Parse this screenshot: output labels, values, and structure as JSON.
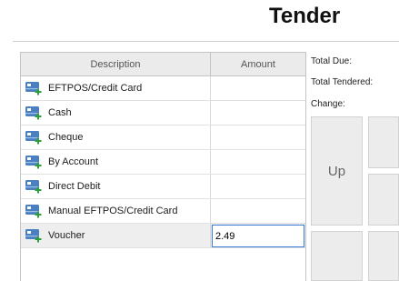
{
  "page": {
    "title": "Tender"
  },
  "grid": {
    "columns": {
      "description": "Description",
      "amount": "Amount"
    },
    "rows": [
      {
        "description": "EFTPOS/Credit Card",
        "amount": "",
        "icon": "card-payment-icon"
      },
      {
        "description": "Cash",
        "amount": "",
        "icon": "card-payment-icon"
      },
      {
        "description": "Cheque",
        "amount": "",
        "icon": "card-payment-icon"
      },
      {
        "description": "By Account",
        "amount": "",
        "icon": "card-payment-icon"
      },
      {
        "description": "Direct Debit",
        "amount": "",
        "icon": "card-payment-icon"
      },
      {
        "description": "Manual EFTPOS/Credit Card",
        "amount": "",
        "icon": "card-payment-icon"
      },
      {
        "description": "Voucher",
        "amount": "2.49",
        "icon": "card-payment-icon",
        "selected": true
      }
    ]
  },
  "summary": {
    "total_due_label": "Total Due:",
    "total_tendered_label": "Total Tendered:",
    "change_label": "Change:"
  },
  "keypad": {
    "up_label": "Up"
  },
  "colors": {
    "icon_card": "#4a7fc0",
    "icon_plus": "#2e9e3c",
    "input_focus_border": "#3a7bd5",
    "selected_row": "#eeeeee",
    "header_bg": "#ebebeb"
  }
}
